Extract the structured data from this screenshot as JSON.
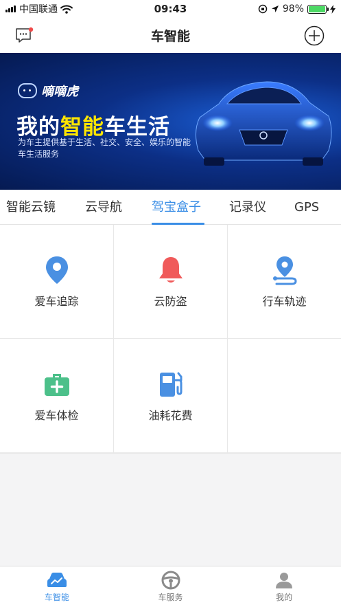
{
  "status_bar": {
    "carrier": "中国联通",
    "time": "09:43",
    "battery": "98%",
    "battery_level": 0.98
  },
  "nav": {
    "title": "车智能",
    "message_icon": "message-icon",
    "add_icon": "plus-circle-icon"
  },
  "banner": {
    "brand": "嘀嘀虎",
    "headline_prefix": "我的",
    "headline_highlight": "智能",
    "headline_suffix": "车生活",
    "description": "为车主提供基于生活、社交、安全、娱乐的智能车生活服务"
  },
  "tabs": [
    {
      "label": "智能云镜"
    },
    {
      "label": "云导航"
    },
    {
      "label": "驾宝盒子",
      "active": true
    },
    {
      "label": "记录仪"
    },
    {
      "label": "GPS"
    }
  ],
  "features": [
    {
      "label": "爱车追踪",
      "icon": "location-pin-icon",
      "color": "#4a90e2"
    },
    {
      "label": "云防盗",
      "icon": "bell-icon",
      "color": "#f05a5a"
    },
    {
      "label": "行车轨迹",
      "icon": "route-icon",
      "color": "#4a90e2"
    },
    {
      "label": "爱车体检",
      "icon": "medical-kit-icon",
      "color": "#4cc08a"
    },
    {
      "label": "油耗花费",
      "icon": "fuel-pump-icon",
      "color": "#4a90e2"
    }
  ],
  "tab_bar": [
    {
      "label": "车智能",
      "icon": "car-icon",
      "active": true
    },
    {
      "label": "车服务",
      "icon": "steering-wheel-icon"
    },
    {
      "label": "我的",
      "icon": "user-icon"
    }
  ],
  "colors": {
    "accent": "#3a8ee6",
    "highlight": "#ffe500",
    "banner_bg": "#0c2f86"
  }
}
